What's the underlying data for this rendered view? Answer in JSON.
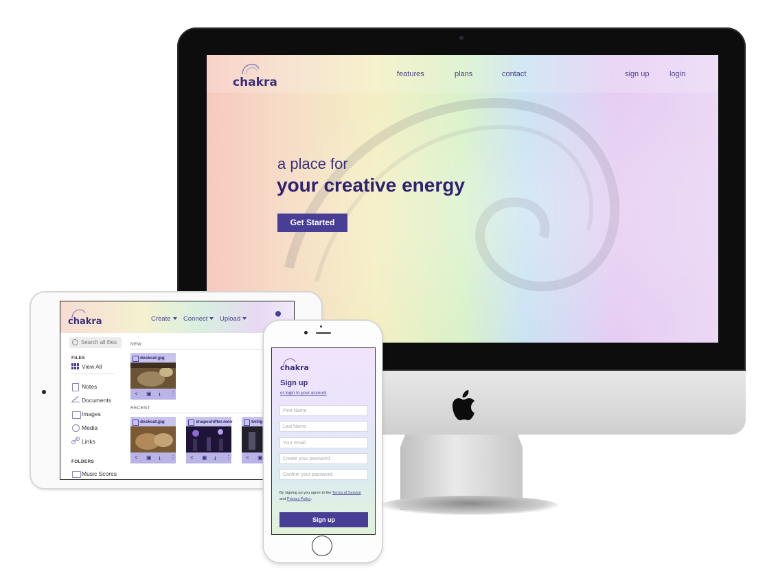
{
  "desktop": {
    "logo": "chakra",
    "nav": [
      "features",
      "plans",
      "contact"
    ],
    "auth": [
      "sign up",
      "login"
    ],
    "hero_line1": "a place for",
    "hero_line2": "your creative energy",
    "cta": "Get Started"
  },
  "tablet": {
    "logo": "chakra",
    "menu": [
      "Create",
      "Connect",
      "Upload"
    ],
    "search_placeholder": "Search all files",
    "files_heading": "FILES",
    "view_all": "View All",
    "sidebar_items": [
      "Notes",
      "Documents",
      "Images",
      "Media",
      "Links"
    ],
    "folders_heading": "FOLDERS",
    "folder_items": [
      "Music Scores"
    ],
    "new_label": "NEW",
    "recent_label": "RECENT",
    "new_files": [
      "deskcat.jpg"
    ],
    "recent_files": [
      "deskcat.jpg",
      "shapeshifter.mov",
      "twiligh"
    ]
  },
  "phone": {
    "logo": "chakra",
    "title": "Sign up",
    "login_link": "or login to your account",
    "fields": [
      "First Name",
      "Last Name",
      "Your email",
      "Create your password",
      "Confirm your password"
    ],
    "terms_prefix": "By signing up you agree to the",
    "terms_link": "Terms of Service",
    "terms_and": "and",
    "privacy_link": "Privacy Policy",
    "terms_suffix": ".",
    "submit": "Sign up"
  },
  "colors": {
    "brand_primary": "#483e96",
    "brand_text": "#3b2f7a"
  }
}
